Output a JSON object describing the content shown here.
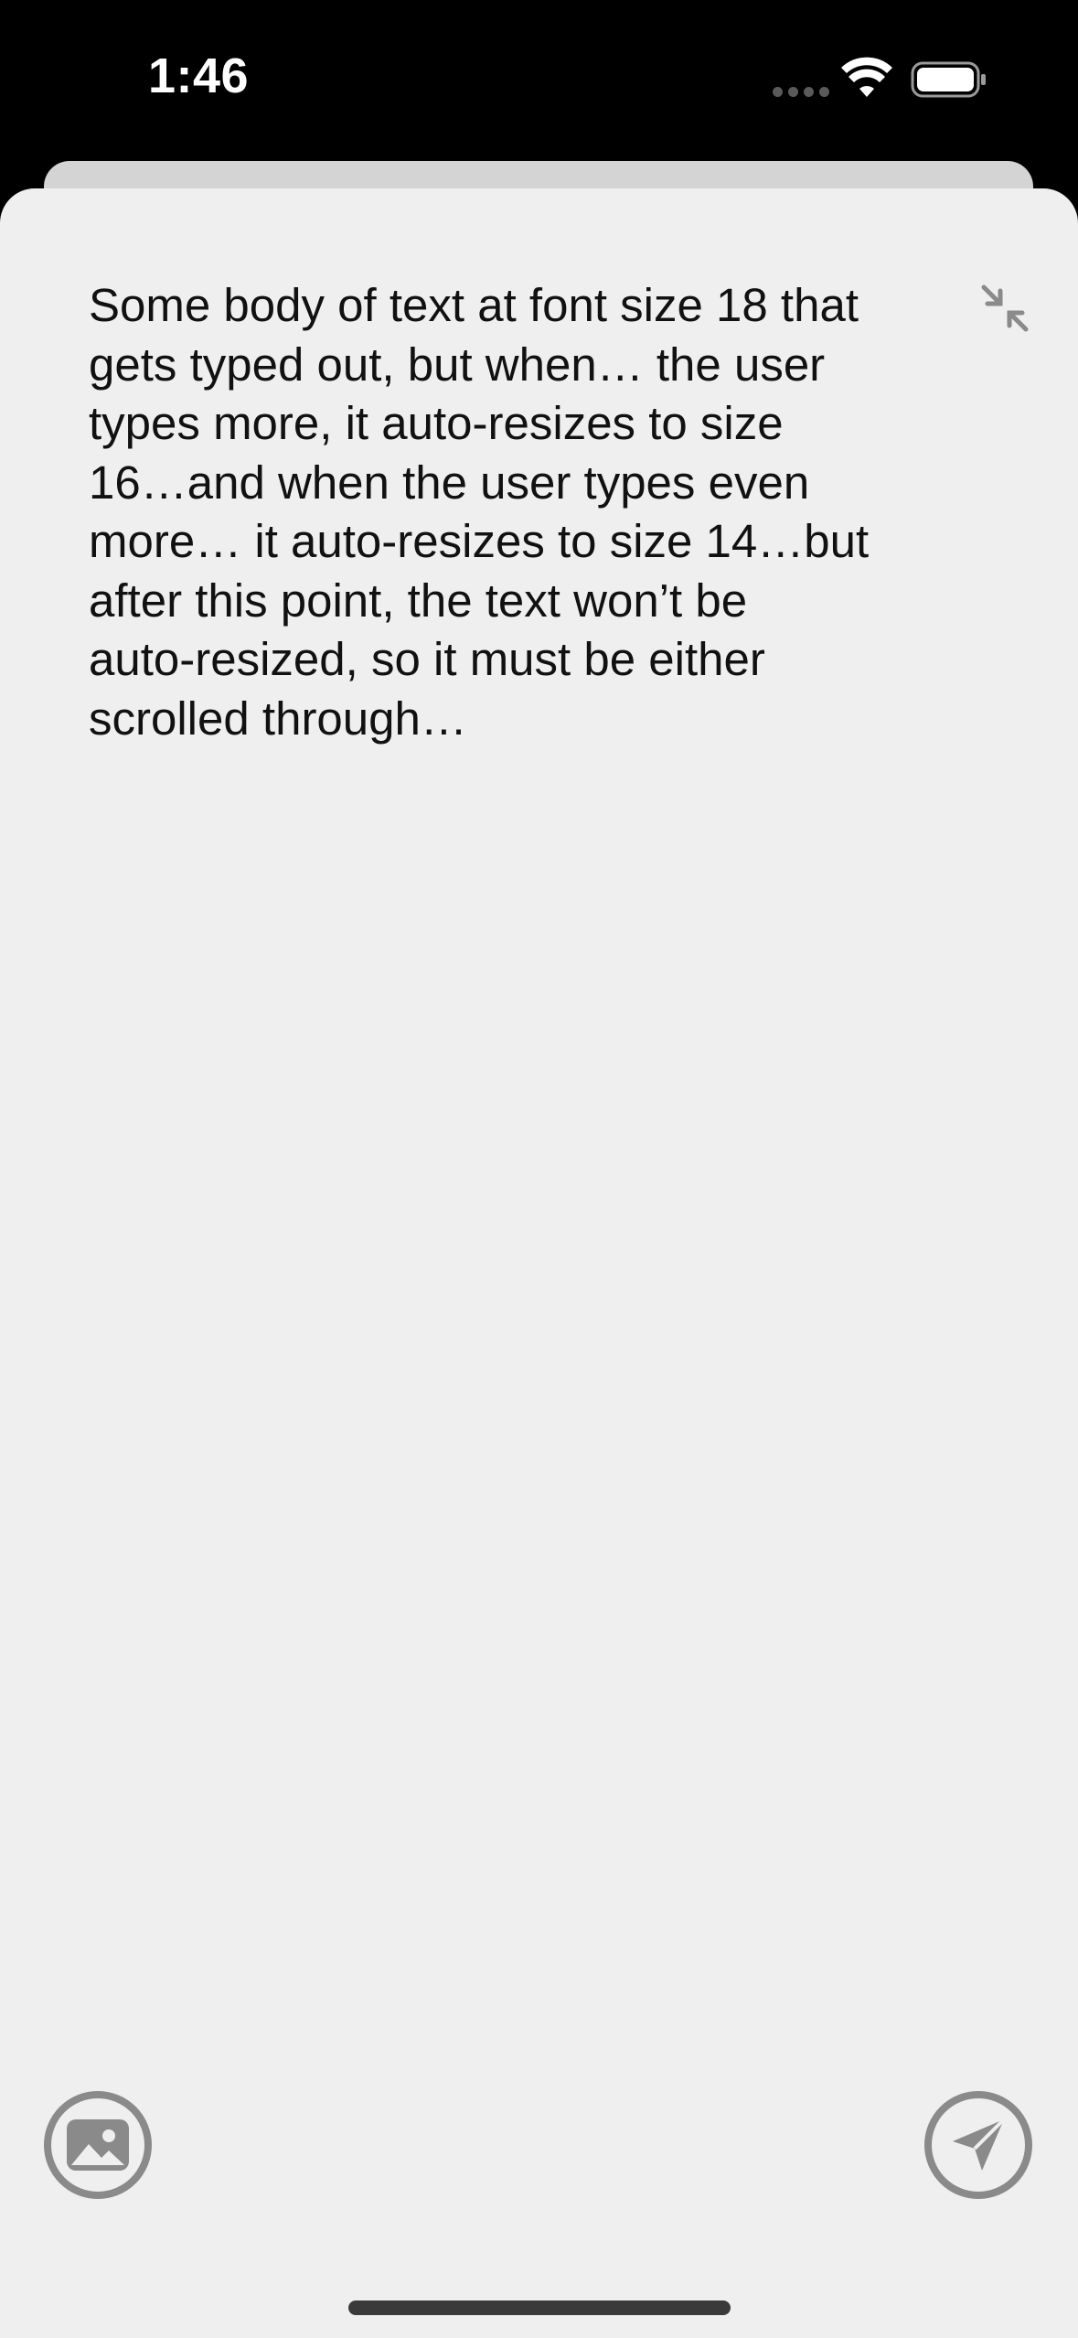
{
  "status_bar": {
    "time": "1:46",
    "icons": [
      "signal-icon",
      "wifi-icon",
      "battery-icon"
    ]
  },
  "editor": {
    "text": "Some body of text at font size 18 that\ngets typed out, but when… the user\ntypes more, it auto-resizes to size\n16…and when the user types even\nmore… it auto-resizes to size 14…but\nafter this point, the text won’t be\nauto-resized, so it must be either\nscrolled through…"
  },
  "toolbar": {
    "collapse_icon": "collapse-arrows-icon",
    "image_icon": "photo-icon",
    "send_icon": "paper-plane-icon"
  },
  "colors": {
    "sheet_background": "#efefef",
    "icon_gray": "#8a8a8a",
    "text": "#111111"
  }
}
